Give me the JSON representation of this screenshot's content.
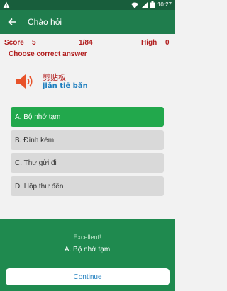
{
  "status_bar": {
    "time": "10:27"
  },
  "app_bar": {
    "title": "Chào hỏi"
  },
  "score": {
    "label": "Score",
    "value": "5",
    "progress": "1/84",
    "high_label": "High",
    "high_value": "0"
  },
  "question": {
    "prompt": "Choose correct answer",
    "hanzi": "剪贴板",
    "pinyin": "jiǎn tiē bǎn"
  },
  "options": [
    {
      "label": "A. Bộ nhớ tạm",
      "state": "correct"
    },
    {
      "label": "B. Đính kèm",
      "state": "default"
    },
    {
      "label": "C. Thư gửi đi",
      "state": "default"
    },
    {
      "label": "D. Hộp thư đến",
      "state": "default"
    }
  ],
  "result": {
    "message": "Excellent!",
    "answer": "A. Bộ nhớ tạm",
    "continue_label": "Continue"
  },
  "colors": {
    "accent": "#1f7d4d",
    "correct": "#22a84c",
    "score_text": "#b11d1d",
    "pinyin": "#1f7fbf"
  }
}
